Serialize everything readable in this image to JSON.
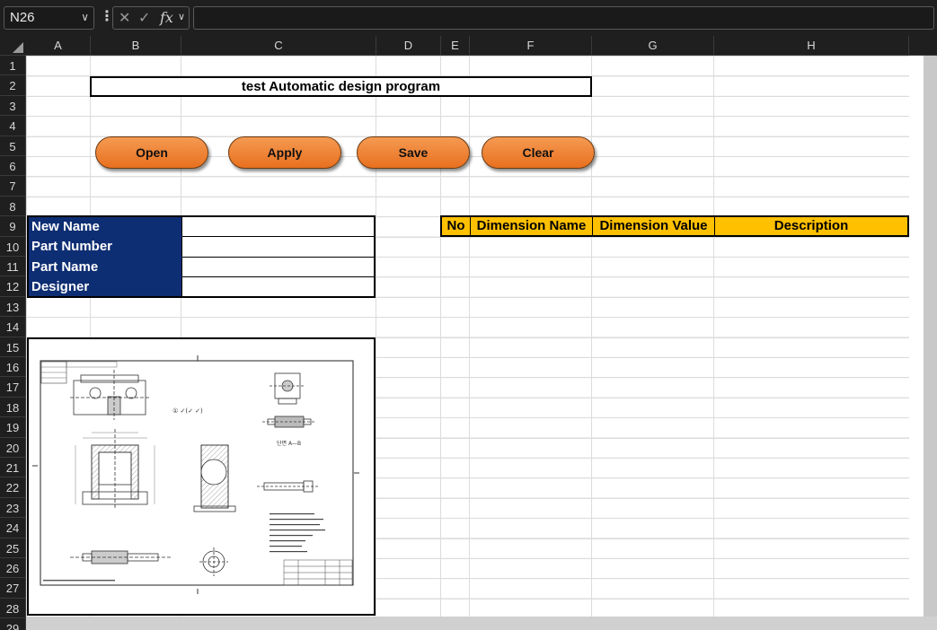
{
  "formula_bar": {
    "name_box": "N26",
    "cancel_glyph": "✕",
    "confirm_glyph": "✓",
    "fx_label": "fx",
    "formula_value": ""
  },
  "columns": [
    "A",
    "B",
    "C",
    "D",
    "E",
    "F",
    "G",
    "H"
  ],
  "rows": [
    "1",
    "2",
    "3",
    "4",
    "5",
    "6",
    "7",
    "8",
    "9",
    "10",
    "11",
    "12",
    "13",
    "14",
    "15",
    "16",
    "17",
    "18",
    "19",
    "20",
    "21",
    "22",
    "23",
    "24",
    "25",
    "26",
    "27",
    "28",
    "29"
  ],
  "sheet": {
    "title": "test  Automatic design program",
    "buttons": {
      "open": "Open",
      "apply": "Apply",
      "save": "Save",
      "clear": "Clear"
    },
    "info_fields": [
      {
        "label": "New Name",
        "value": ""
      },
      {
        "label": "Part Number",
        "value": ""
      },
      {
        "label": "Part Name",
        "value": ""
      },
      {
        "label": "Designer",
        "value": ""
      }
    ],
    "dimension_table": {
      "headers": [
        "No",
        "Dimension Name",
        "Dimension Value",
        "Description"
      ]
    },
    "drawing": {
      "section_label": "단면 A—B"
    }
  },
  "colors": {
    "button_orange": "#ed7d31",
    "label_navy": "#0e2e73",
    "header_gold": "#ffc000"
  },
  "icons": [
    "chevron-down-icon",
    "more-options-icon",
    "cancel-icon",
    "confirm-icon",
    "function-icon",
    "select-all-icon"
  ]
}
